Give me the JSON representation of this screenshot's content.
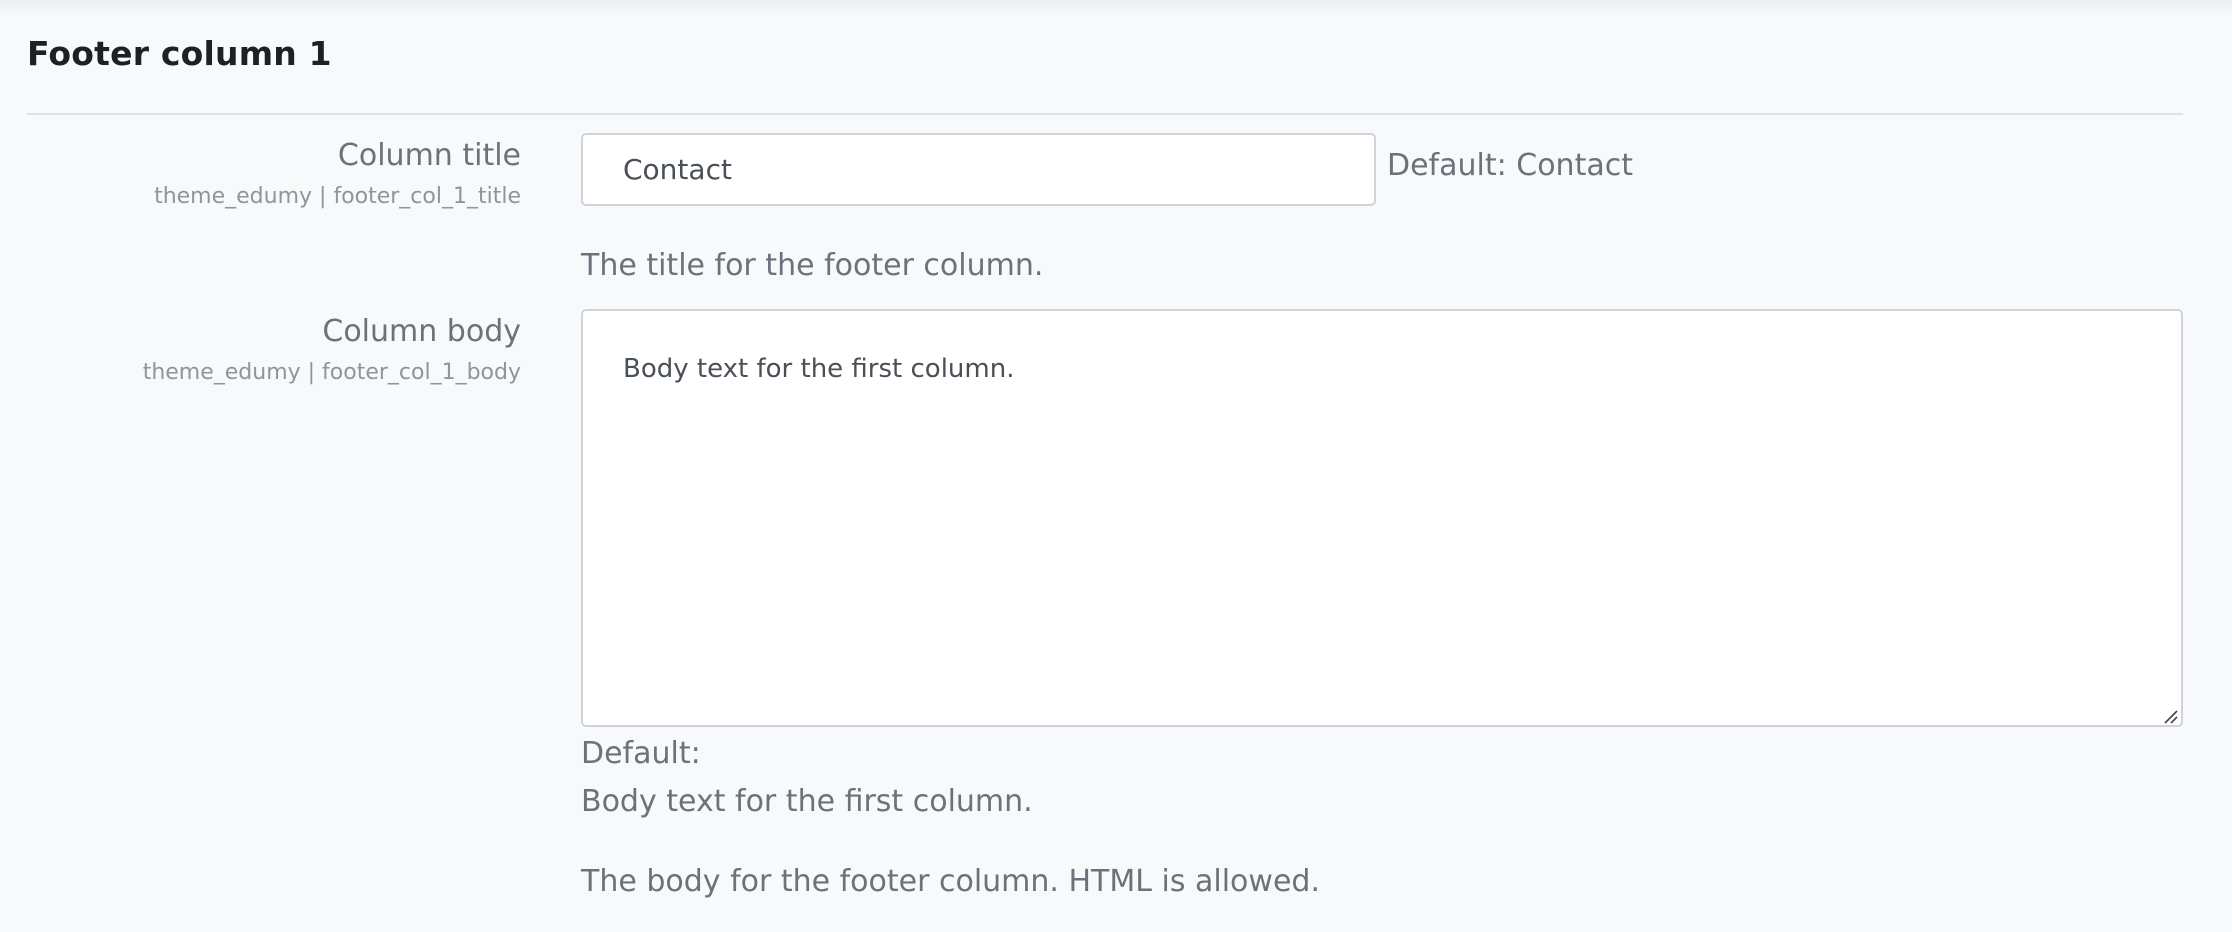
{
  "section": {
    "title": "Footer column 1"
  },
  "settings": [
    {
      "label": "Column title",
      "key": "theme_edumy | footer_col_1_title",
      "value": "Contact",
      "default_text": "Default: Contact",
      "description": "The title for the footer column."
    },
    {
      "label": "Column body",
      "key": "theme_edumy | footer_col_1_body",
      "value": "Body text for the first column.",
      "default_label": "Default:",
      "default_value": "Body text for the first column.",
      "description": "The body for the footer column. HTML is allowed."
    }
  ],
  "colors": {
    "background": "#f8f9fa",
    "text_muted": "#6a737b",
    "border": "#ced4da"
  },
  "icons": {
    "resize_handle": "resize-grip-icon"
  }
}
